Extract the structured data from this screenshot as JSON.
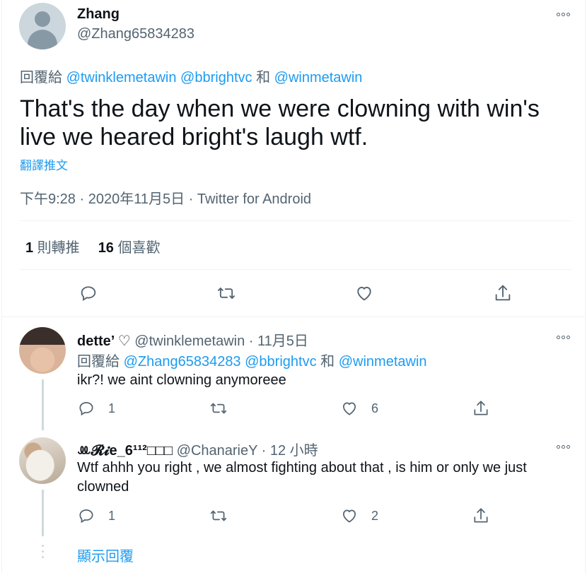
{
  "main_tweet": {
    "name": "Zhang",
    "handle": "@Zhang65834283",
    "replying_prefix": "回覆給 ",
    "replying_to": [
      "@twinklemetawin",
      "@bbrightvc",
      "@winmetawin"
    ],
    "replying_sep": " ",
    "replying_and": " 和 ",
    "text": "That's the day when we were clowning with win's live we heared bright's laugh wtf.",
    "translate_label": "翻譯推文",
    "timestamp": "下午9:28 · 2020年11月5日 · Twitter for Android",
    "retweets_count": "1",
    "retweets_label": " 則轉推",
    "likes_count": "16",
    "likes_label": " 個喜歡"
  },
  "replies": [
    {
      "name": "dette’ ♡",
      "meta": " @twinklemetawin · 11月5日",
      "replying_prefix": "回覆給 ",
      "replying_to": [
        "@Zhang65834283",
        "@bbrightvc",
        "@winmetawin"
      ],
      "replying_sep": " ",
      "replying_and": " 和 ",
      "text": "ikr?! we aint clowning anymoreee",
      "reply_count": "1",
      "retweet_count": "",
      "like_count": "6"
    },
    {
      "name": "ꔛ𝓡𝓲e_6¹¹²□□□",
      "meta": " @ChanarieY · 12 小時",
      "text": "Wtf ahhh you right , we almost fighting about that , is him or only we just clowned",
      "reply_count": "1",
      "retweet_count": "",
      "like_count": "2"
    }
  ],
  "show_replies_label": "顯示回覆",
  "icons": {
    "reply": "reply-icon",
    "retweet": "retweet-icon",
    "like": "heart-icon",
    "share": "share-icon",
    "more": "more-icon"
  },
  "colors": {
    "link": "#1d9bf0",
    "secondary_text": "#536471",
    "primary_text": "#0f1419"
  }
}
